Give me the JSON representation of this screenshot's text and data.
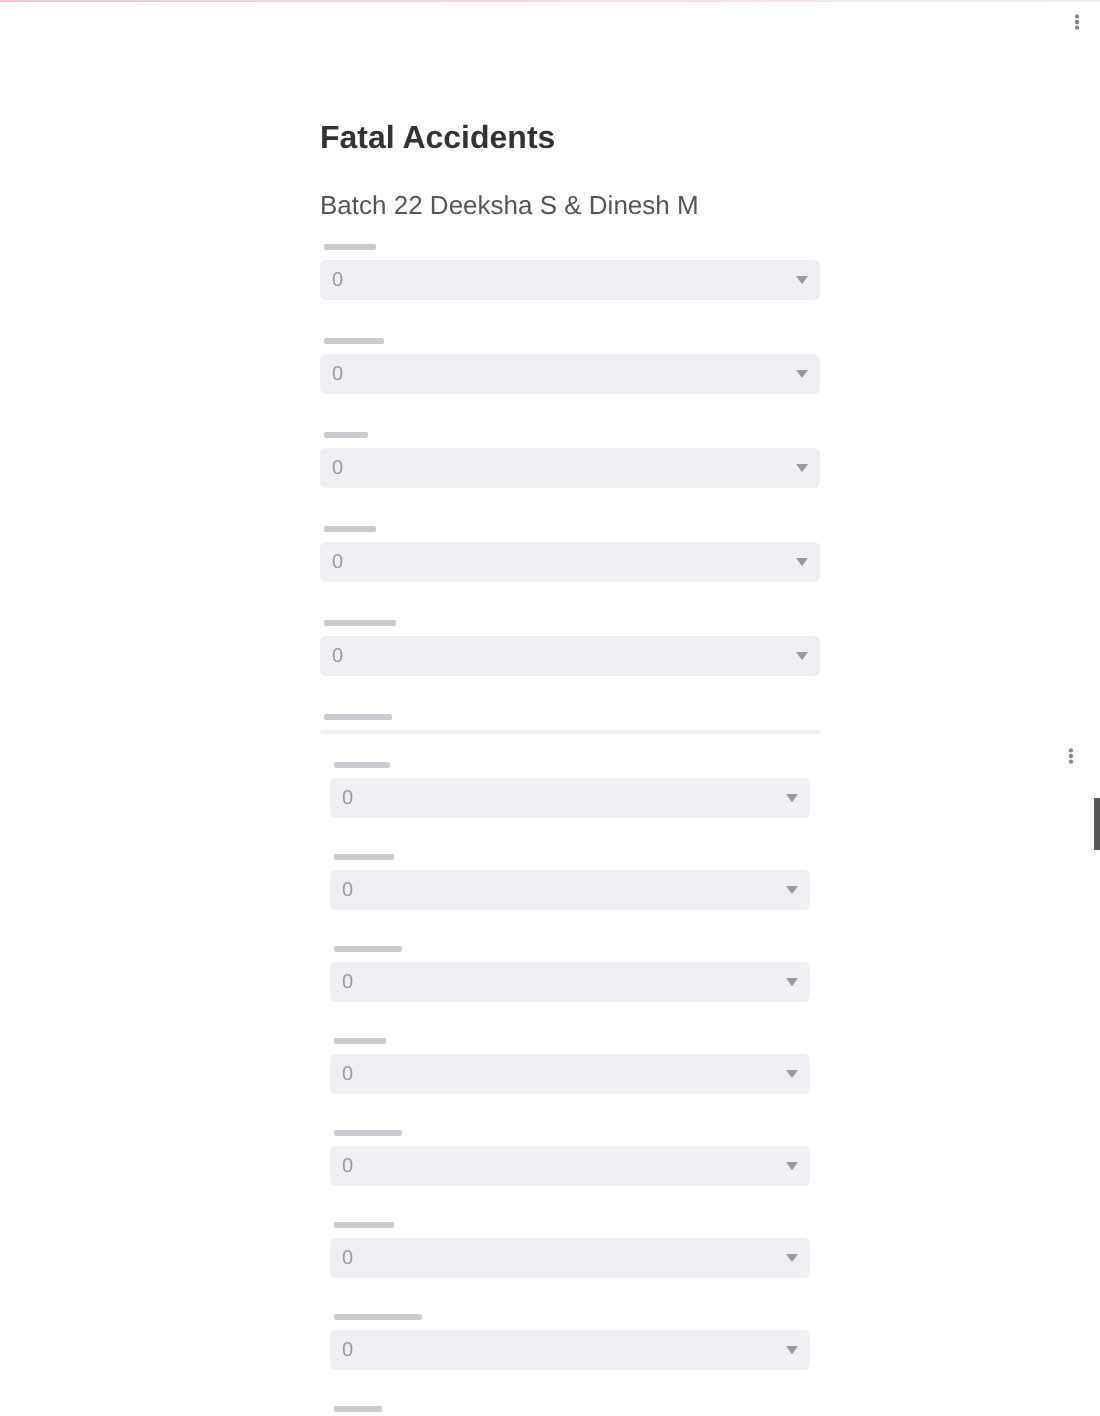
{
  "top_panel": {
    "title": "Fatal Accidents",
    "subtitle": "Batch 22 Deeksha S & Dinesh M",
    "fields": [
      {
        "kind": "select",
        "value": "0"
      },
      {
        "kind": "select",
        "value": "0"
      },
      {
        "kind": "select",
        "value": "0"
      },
      {
        "kind": "select",
        "value": "0"
      },
      {
        "kind": "select",
        "value": "0"
      },
      {
        "kind": "cut"
      }
    ]
  },
  "bottom_panel": {
    "fields": [
      {
        "kind": "select",
        "value": "0"
      },
      {
        "kind": "select",
        "value": "0"
      },
      {
        "kind": "select",
        "value": "0"
      },
      {
        "kind": "select",
        "value": "0"
      },
      {
        "kind": "select",
        "value": "0"
      },
      {
        "kind": "select",
        "value": "0"
      },
      {
        "kind": "select",
        "value": "0"
      },
      {
        "kind": "label_only"
      }
    ]
  }
}
